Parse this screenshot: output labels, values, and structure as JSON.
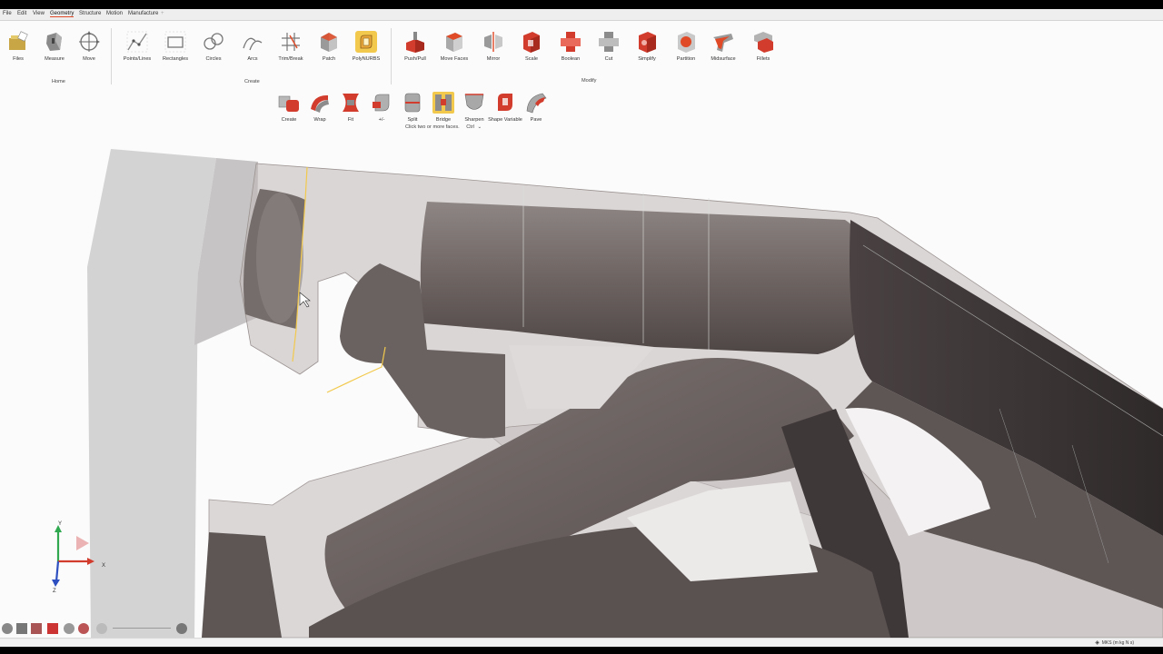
{
  "menu": {
    "items": [
      "File",
      "Edit",
      "View",
      "Geometry",
      "Structure",
      "Motion",
      "Manufacture"
    ],
    "active": "Geometry",
    "add": "+"
  },
  "ribbon": {
    "home": {
      "tools": [
        "Files",
        "Measure",
        "Move"
      ],
      "label": "Home"
    },
    "create": {
      "tools": [
        "Points/Lines",
        "Rectangles",
        "Circles",
        "Arcs",
        "Trim/Break",
        "Patch",
        "PolyNURBS"
      ],
      "label": "Create"
    },
    "modify": {
      "tools": [
        "Push/Pull",
        "Move Faces",
        "Mirror",
        "Scale",
        "Boolean",
        "Cut",
        "Simplify",
        "Partition",
        "Midsurface",
        "Fillets"
      ],
      "label": "Modify"
    },
    "polynurbs_tools": [
      "Create",
      "Wrap",
      "Fit",
      "+/-",
      "Split",
      "Bridge",
      "Sharpen",
      "Shape Variable",
      "Pave"
    ],
    "hint": "Click two or more faces.",
    "hint_shortcut": "Ctrl"
  },
  "triad": {
    "x": "X",
    "y": "Y",
    "z": "Z"
  },
  "status": {
    "units": "MKS (m kg N s)"
  },
  "colors": {
    "accent": "#e04a26",
    "highlight": "#f2c94c",
    "model": "#6e6563"
  }
}
